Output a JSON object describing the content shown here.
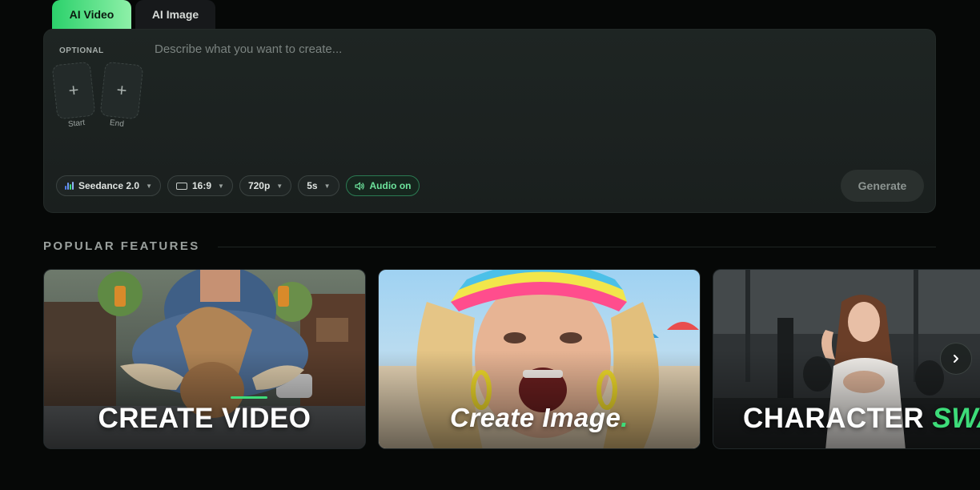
{
  "tabs": [
    {
      "label": "AI Video",
      "active": true
    },
    {
      "label": "AI Image",
      "active": false
    }
  ],
  "prompt": {
    "optional_label": "OPTIONAL",
    "start_label": "Start",
    "end_label": "End",
    "add_glyph": "+",
    "placeholder": "Describe what you want to create..."
  },
  "controls": {
    "model": "Seedance 2.0",
    "aspect": "16:9",
    "resolution": "720p",
    "duration": "5s",
    "audio": "Audio on",
    "generate": "Generate"
  },
  "section": {
    "title": "POPULAR FEATURES"
  },
  "cards": [
    {
      "title": "CREATE VIDEO"
    },
    {
      "title": "Create Image",
      "title_dot": "."
    },
    {
      "title_a": "CHARACTER ",
      "title_b": "SWA"
    }
  ],
  "colors": {
    "accent": "#3ddc79",
    "background": "#060807",
    "panel": "#1e2523"
  },
  "icons": {
    "model": "bars-icon",
    "aspect": "aspect-ratio-icon",
    "audio": "speaker-icon",
    "chevron": "chevron-down-icon",
    "next": "chevron-right-icon"
  }
}
